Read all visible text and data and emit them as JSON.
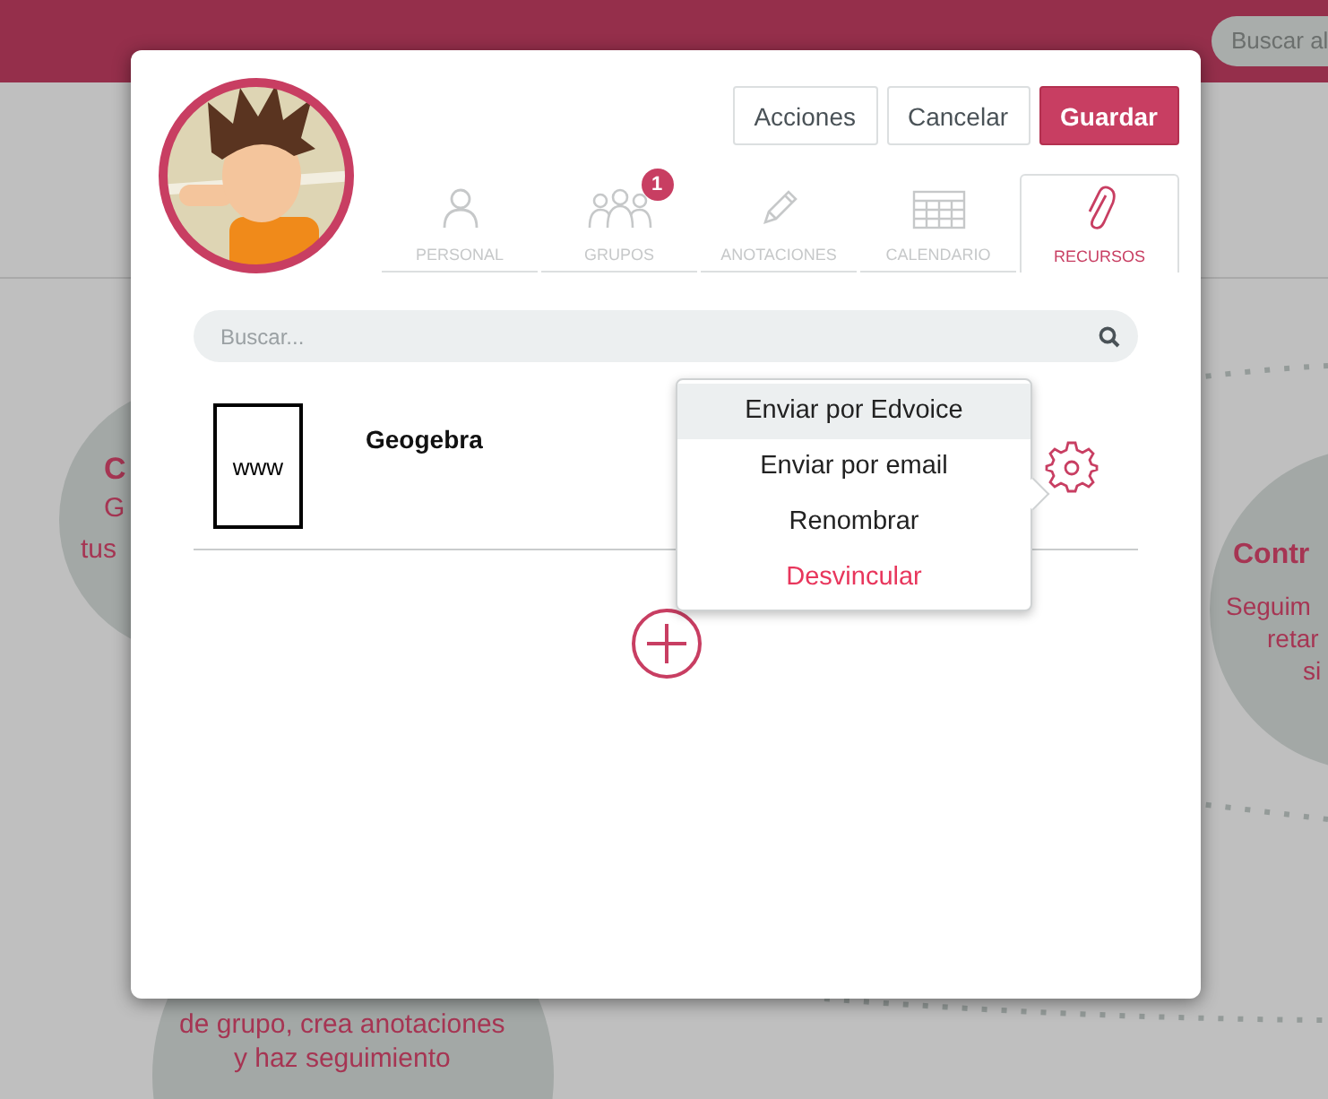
{
  "top_bar": {
    "search": {
      "placeholder": "Buscar al"
    }
  },
  "background": {
    "left_card": {
      "title": "C",
      "lines": [
        "G",
        "tus"
      ]
    },
    "right_card": {
      "title": "Contr",
      "lines": [
        "Seguim",
        "retar",
        "si"
      ]
    },
    "bottom_card": {
      "lines": [
        "de grupo, crea anotaciones",
        "y haz seguimiento"
      ]
    }
  },
  "dialog": {
    "buttons": [
      {
        "label": "Acciones",
        "kind": "default"
      },
      {
        "label": "Cancelar",
        "kind": "default"
      },
      {
        "label": "Guardar",
        "kind": "primary"
      }
    ],
    "tabs": [
      {
        "label": "PERSONAL",
        "selected": false
      },
      {
        "label": "GRUPOS",
        "badge": "1",
        "selected": false
      },
      {
        "label": "ANOTACIONES",
        "selected": false
      },
      {
        "label": "CALENDARIO",
        "selected": false
      },
      {
        "label": "RECURSOS",
        "selected": true
      }
    ],
    "search": {
      "placeholder": "Buscar..."
    },
    "resources": [
      {
        "icon_text": "www",
        "name": "Geogebra"
      }
    ],
    "menu": [
      {
        "label": "Enviar por Edvoice",
        "kind": "normal",
        "selected": true
      },
      {
        "label": "Enviar por email",
        "kind": "normal",
        "selected": false
      },
      {
        "label": "Renombrar",
        "kind": "normal",
        "selected": false
      },
      {
        "label": "Desvincular",
        "kind": "danger",
        "selected": false
      }
    ]
  }
}
